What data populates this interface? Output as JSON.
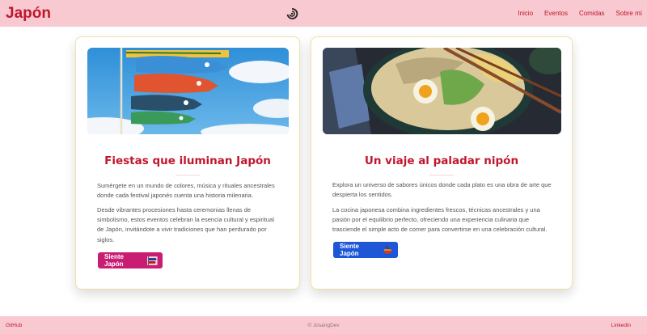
{
  "header": {
    "brand": "Japón",
    "center_icon": "spiral-icon",
    "nav": [
      "Inicio",
      "Eventos",
      "Comidas",
      "Sobre mí"
    ]
  },
  "cards": [
    {
      "image": "koinobori-carp-streamers",
      "title": "Fiestas que iluminan Japón",
      "p1": "Sumérgete en un mundo de colores, música y rituales ancestrales donde cada festival japonés cuenta una historia milenaria.",
      "p2": "Desde vibrantes procesiones hasta ceremonias llenas de simbolismo, estos eventos celebran la esencia cultural y espiritual de Japón, invitándote a vivir tradiciones que han perdurado por siglos.",
      "button": "Siente Japón",
      "button_icon": "koinobori-icon",
      "button_color": "#c81d73"
    },
    {
      "image": "ramen-bowl",
      "title": "Un viaje al paladar nipón",
      "p1": "Explora un universo de sabores únicos donde cada plato es una obra de arte que despierta los sentidos.",
      "p2": "La cocina japonesa combina ingredientes frescos, técnicas ancestrales y una pasión por el equilibrio perfecto, ofreciendo una experiencia culinaria que trasciende el simple acto de comer para convertirse en una celebración cultural.",
      "button": "Siente Japón",
      "button_icon": "ramen-icon",
      "button_color": "#1d57d8"
    }
  ],
  "footer": {
    "left": "GitHub",
    "center": "© JosangDev",
    "right": "Linkedin"
  },
  "colors": {
    "header_bg": "#f8c9d0",
    "accent": "#c0172d"
  }
}
